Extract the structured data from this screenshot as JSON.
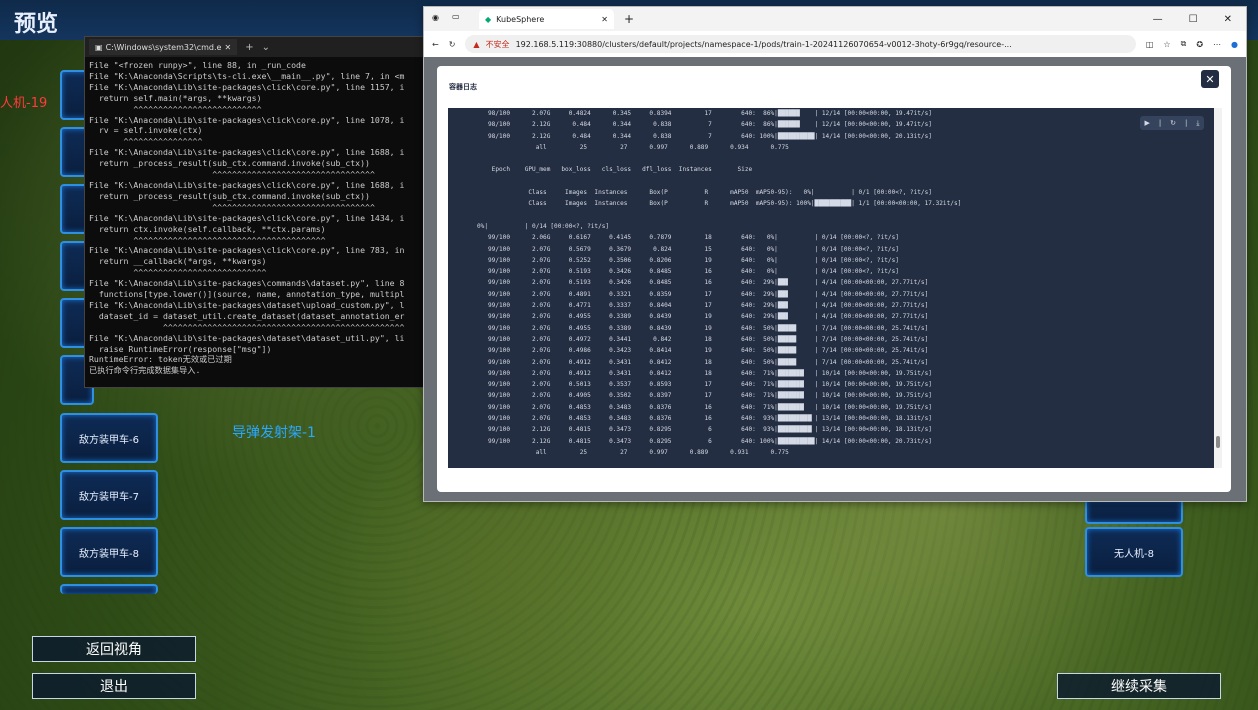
{
  "app": {
    "title": "预览",
    "scene_label_1": "人机-19",
    "scene_label_2": "导弹发射架-1",
    "left_buttons": [
      "敌方装甲车-6",
      "敌方装甲车-7",
      "敌方装甲车-8"
    ],
    "right_buttons": [
      "无人机-8"
    ],
    "back_view": "返回视角",
    "exit": "退出",
    "continue": "继续采集"
  },
  "cmd": {
    "tab_title": "C:\\Windows\\system32\\cmd.e",
    "lines": "File \"<frozen runpy>\", line 88, in _run_code\nFile \"K:\\Anaconda\\Scripts\\ts-cli.exe\\__main__.py\", line 7, in <m\nFile \"K:\\Anaconda\\Lib\\site-packages\\click\\core.py\", line 1157, i\n  return self.main(*args, **kwargs)\n         ^^^^^^^^^^^^^^^^^^^^^^^^^^\nFile \"K:\\Anaconda\\Lib\\site-packages\\click\\core.py\", line 1078, i\n  rv = self.invoke(ctx)\n       ^^^^^^^^^^^^^^^^\nFile \"K:\\Anaconda\\Lib\\site-packages\\click\\core.py\", line 1688, i\n  return _process_result(sub_ctx.command.invoke(sub_ctx))\n                         ^^^^^^^^^^^^^^^^^^^^^^^^^^^^^^^^^\nFile \"K:\\Anaconda\\Lib\\site-packages\\click\\core.py\", line 1688, i\n  return _process_result(sub_ctx.command.invoke(sub_ctx))\n                         ^^^^^^^^^^^^^^^^^^^^^^^^^^^^^^^^^\nFile \"K:\\Anaconda\\Lib\\site-packages\\click\\core.py\", line 1434, i\n  return ctx.invoke(self.callback, **ctx.params)\n         ^^^^^^^^^^^^^^^^^^^^^^^^^^^^^^^^^^^^^^^\nFile \"K:\\Anaconda\\Lib\\site-packages\\click\\core.py\", line 783, in\n  return __callback(*args, **kwargs)\n         ^^^^^^^^^^^^^^^^^^^^^^^^^^^\nFile \"K:\\Anaconda\\Lib\\site-packages\\commands\\dataset.py\", line 8\n  functions[type.lower()](source, name, annotation_type, multipl\nFile \"K:\\Anaconda\\Lib\\site-packages\\dataset\\upload_custom.py\", l\n  dataset_id = dataset_util.create_dataset(dataset_annotation_er\n               ^^^^^^^^^^^^^^^^^^^^^^^^^^^^^^^^^^^^^^^^^^^^^^^^^\nFile \"K:\\Anaconda\\Lib\\site-packages\\dataset\\dataset_util.py\", li\n  raise RuntimeError(response[\"msg\"])\nRuntimeError: token无效或已过期\n已执行命令行完成数据集导入."
  },
  "browser": {
    "tab_title": "KubeSphere",
    "url_warning": "不安全",
    "url": "192.168.5.119:30880/clusters/default/projects/namespace-1/pods/train-1-20241126070654-v0012-3hoty-6r9gq/resource-...",
    "modal_title": "容器日志",
    "log_lines": "      98/100      2.07G     0.4824      0.345     0.8394         17        640:  86%|██████    | 12/14 [00:00<00:00, 19.47it/s]\n      98/100      2.12G      0.484      0.344      0.838          7        640:  86%|██████    | 12/14 [00:00<00:00, 19.47it/s]\n      98/100      2.12G      0.484      0.344      0.838          7        640: 100%|██████████| 14/14 [00:00<00:00, 20.13it/s]\n                   all         25         27      0.997      0.889      0.934      0.775\n\n       Epoch    GPU_mem   box_loss   cls_loss   dfl_loss  Instances       Size\n\n                 Class     Images  Instances      Box(P          R      mAP50  mAP50-95):   0%|          | 0/1 [00:00<?, ?it/s]\n                 Class     Images  Instances      Box(P          R      mAP50  mAP50-95): 100%|██████████| 1/1 [00:00<00:00, 17.32it/s]\n\n   0%|          | 0/14 [00:00<?, ?it/s]\n      99/100      2.06G     0.6167     0.4145     0.7879         18        640:   0%|          | 0/14 [00:00<?, ?it/s]\n      99/100      2.07G     0.5679     0.3679      0.824         15        640:   0%|          | 0/14 [00:00<?, ?it/s]\n      99/100      2.07G     0.5252     0.3506     0.8206         19        640:   0%|          | 0/14 [00:00<?, ?it/s]\n      99/100      2.07G     0.5193     0.3426     0.8485         16        640:   0%|          | 0/14 [00:00<?, ?it/s]\n      99/100      2.07G     0.5193     0.3426     0.8485         16        640:  29%|██▊       | 4/14 [00:00<00:00, 27.77it/s]\n      99/100      2.07G     0.4891     0.3321     0.8359         17        640:  29%|██▊       | 4/14 [00:00<00:00, 27.77it/s]\n      99/100      2.07G     0.4771     0.3337     0.8404         17        640:  29%|██▊       | 4/14 [00:00<00:00, 27.77it/s]\n      99/100      2.07G     0.4955     0.3389     0.8439         19        640:  29%|██▊       | 4/14 [00:00<00:00, 27.77it/s]\n      99/100      2.07G     0.4955     0.3389     0.8439         19        640:  50%|█████     | 7/14 [00:00<00:00, 25.74it/s]\n      99/100      2.07G     0.4972     0.3441      0.842         18        640:  50%|█████     | 7/14 [00:00<00:00, 25.74it/s]\n      99/100      2.07G     0.4986     0.3423     0.8414         19        640:  50%|█████     | 7/14 [00:00<00:00, 25.74it/s]\n      99/100      2.07G     0.4912     0.3431     0.8412         18        640:  50%|█████     | 7/14 [00:00<00:00, 25.74it/s]\n      99/100      2.07G     0.4912     0.3431     0.8412         18        640:  71%|███████▏  | 10/14 [00:00<00:00, 19.75it/s]\n      99/100      2.07G     0.5013     0.3537     0.8593         17        640:  71%|███████▏  | 10/14 [00:00<00:00, 19.75it/s]\n      99/100      2.07G     0.4905     0.3502     0.8397         17        640:  71%|███████▏  | 10/14 [00:00<00:00, 19.75it/s]\n      99/100      2.07G     0.4853     0.3483     0.8376         16        640:  71%|███████▏  | 10/14 [00:00<00:00, 19.75it/s]\n      99/100      2.07G     0.4853     0.3483     0.8376         16        640:  93%|█████████▎| 13/14 [00:00<00:00, 18.13it/s]\n      99/100      2.12G     0.4815     0.3473     0.8295          6        640:  93%|█████████▎| 13/14 [00:00<00:00, 18.13it/s]\n      99/100      2.12G     0.4815     0.3473     0.8295          6        640: 100%|██████████| 14/14 [00:00<00:00, 20.73it/s]\n                   all         25         27      0.997      0.889      0.931      0.775"
  }
}
